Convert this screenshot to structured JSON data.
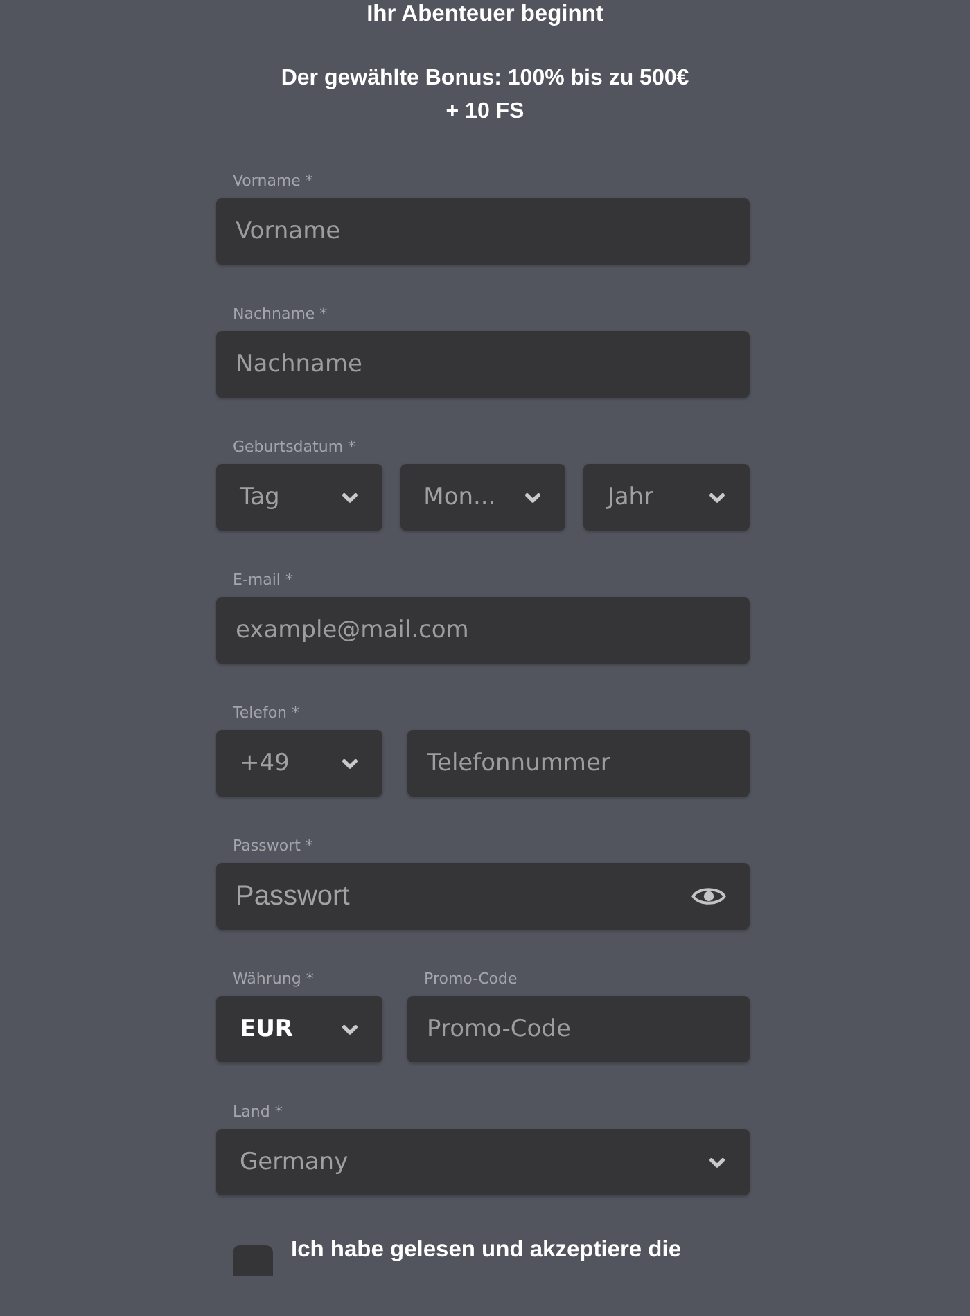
{
  "header": {
    "title": "Ihr Abenteuer beginnt",
    "bonus": "Der gewählte Bonus: 100% bis zu 500€ + 10 FS"
  },
  "rows": [
    {
      "label": "Vorname *",
      "controls": [
        {
          "kind": "text",
          "placeholder": "Vorname"
        }
      ]
    },
    {
      "label": "Nachname *",
      "controls": [
        {
          "kind": "text",
          "placeholder": "Nachname"
        }
      ]
    },
    {
      "label": "Geburtsdatum *",
      "controls": [
        {
          "kind": "select",
          "placeholder": "Tag"
        },
        {
          "kind": "select",
          "placeholder": "Mon..."
        },
        {
          "kind": "select",
          "placeholder": "Jahr"
        }
      ]
    },
    {
      "label": "E-mail *",
      "controls": [
        {
          "kind": "text",
          "placeholder": "example@mail.com"
        }
      ]
    },
    {
      "label": "Telefon *",
      "controls": [
        {
          "kind": "select",
          "value": "+49",
          "highlighted": false
        },
        {
          "kind": "text",
          "placeholder": "Telefonnummer"
        }
      ]
    },
    {
      "label": "Passwort *",
      "controls": [
        {
          "kind": "password",
          "placeholder": "Passwort"
        }
      ]
    },
    {
      "controls": [
        {
          "kind": "select",
          "label": "Währung *",
          "value": "EUR",
          "highlighted": true
        },
        {
          "kind": "text",
          "label": "Promo-Code",
          "placeholder": "Promo-Code"
        }
      ]
    },
    {
      "label": "Land *",
      "controls": [
        {
          "kind": "select",
          "value": "Germany",
          "highlighted": false
        }
      ]
    }
  ],
  "terms": {
    "checked": false,
    "text": "Ich habe gelesen und akzeptiere die"
  }
}
